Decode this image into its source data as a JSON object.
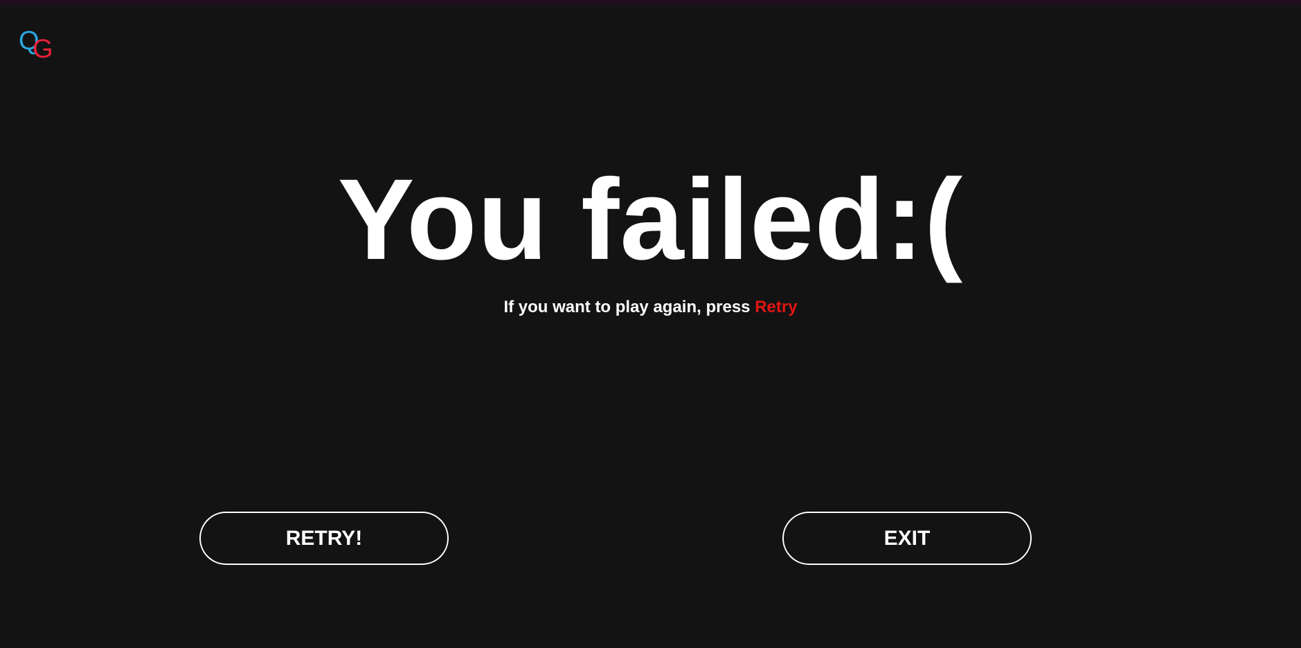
{
  "logo": {
    "letter_1": "Q",
    "letter_2": "G",
    "color_1": "#2aa7e0",
    "color_2": "#e8223a"
  },
  "headline": "You failed:(",
  "subline": {
    "text": "If you want to play again, press ",
    "highlight": "Retry",
    "highlight_color": "#e01414"
  },
  "buttons": {
    "retry_label": "RETRY!",
    "exit_label": "EXIT"
  },
  "colors": {
    "background": "#131313",
    "text": "#ffffff"
  }
}
